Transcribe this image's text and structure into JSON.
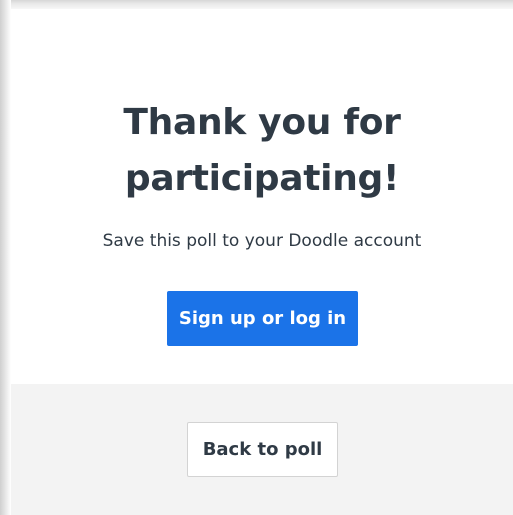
{
  "dialog": {
    "title": "Thank you for participating!",
    "subtitle": "Save this poll to your Doodle account",
    "primary_button": "Sign up or log in",
    "secondary_button": "Back to poll"
  },
  "colors": {
    "primary": "#1b73e8",
    "text": "#2f3a45",
    "footer_background": "#f3f3f3"
  }
}
